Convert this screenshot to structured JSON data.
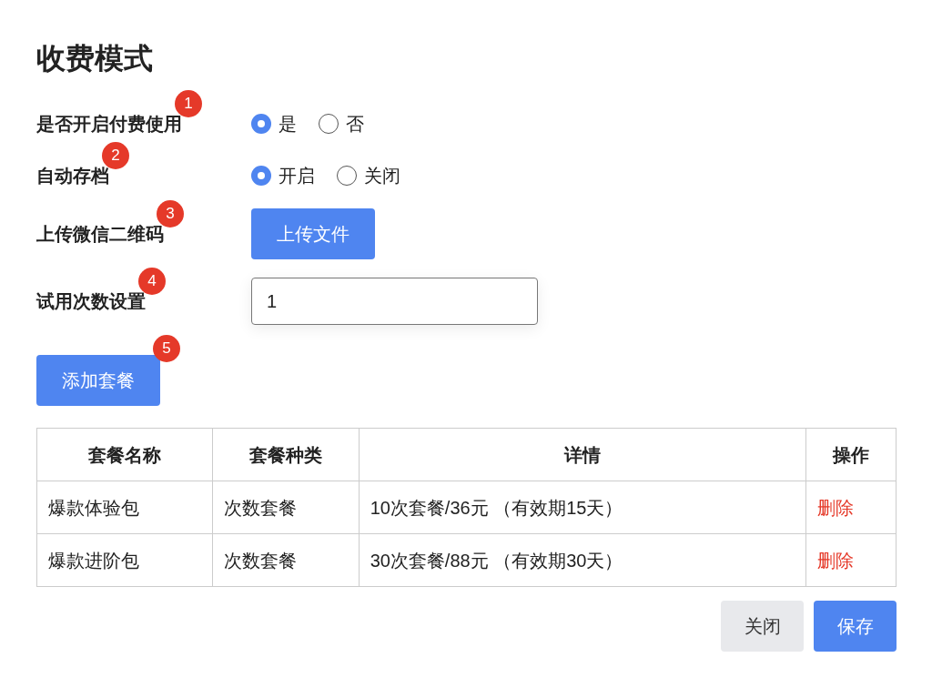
{
  "title": "收费模式",
  "settings": [
    {
      "kind": "radio",
      "label": "是否开启付费使用",
      "badge": "1",
      "options": [
        {
          "label": "是",
          "selected": true
        },
        {
          "label": "否",
          "selected": false
        }
      ]
    },
    {
      "kind": "radio",
      "label": "自动存档",
      "badge": "2",
      "options": [
        {
          "label": "开启",
          "selected": true
        },
        {
          "label": "关闭",
          "selected": false
        }
      ]
    },
    {
      "kind": "upload",
      "label": "上传微信二维码",
      "badge": "3",
      "button": "上传文件"
    },
    {
      "kind": "input",
      "label": "试用次数设置",
      "badge": "4",
      "value": "1"
    }
  ],
  "add_button": {
    "label": "添加套餐",
    "badge": "5"
  },
  "table": {
    "columns": [
      "套餐名称",
      "套餐种类",
      "详情",
      "操作"
    ],
    "rows": [
      {
        "cells": [
          "爆款体验包",
          "次数套餐",
          "10次套餐/36元 （有效期15天）"
        ],
        "action": "删除"
      },
      {
        "cells": [
          "爆款进阶包",
          "次数套餐",
          "30次套餐/88元 （有效期30天）"
        ],
        "action": "删除"
      }
    ]
  },
  "footer": {
    "close": "关闭",
    "save": "保存"
  }
}
